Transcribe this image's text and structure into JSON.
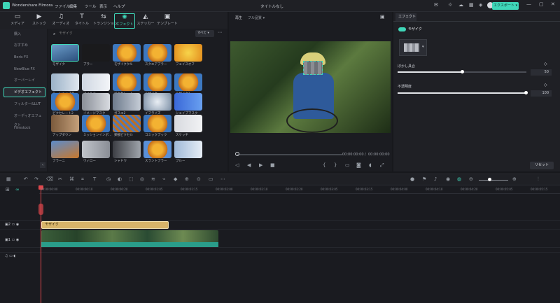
{
  "app": {
    "title": "Wondershare Filmora",
    "doc_title": "タイトルなし",
    "export_label": "エクスポート"
  },
  "menu": [
    "ファイル",
    "編集",
    "ツール",
    "表示",
    "ヘルプ"
  ],
  "toolbar": [
    {
      "label": "メディア",
      "icon": "media-icon"
    },
    {
      "label": "ストック",
      "icon": "stock-icon"
    },
    {
      "label": "オーディオ",
      "icon": "audio-icon"
    },
    {
      "label": "タイトル",
      "icon": "title-icon"
    },
    {
      "label": "トランジション",
      "icon": "transition-icon"
    },
    {
      "label": "エフェクト",
      "icon": "effects-icon",
      "active": true
    },
    {
      "label": "ステッカー",
      "icon": "sticker-icon"
    },
    {
      "label": "テンプレート",
      "icon": "template-icon"
    }
  ],
  "sidebar": [
    "購入",
    "おすすめ",
    "Boris FX",
    "NewBlue FX",
    "オーバーレイ",
    "ビデオエフェクト",
    "フィルター&LUT",
    "オーディオエフェクト",
    "Filmstock"
  ],
  "search": {
    "placeholder": "モザイク",
    "filter": "すべて"
  },
  "effects": [
    "モザイク",
    "ブラー",
    "モザイククル",
    "スクエアブラー",
    "フェイスオフ",
    "モーションブラー",
    "マイルド",
    "ピクセレート",
    "モザイク",
    "モザイク1",
    "ピクセレート2",
    "イメージマスク",
    "ガスエ2",
    "イフライズ",
    "シェイプマスク",
    "アップダウン",
    "ミッションインポ…",
    "楽観ピクセル",
    "コミックブック",
    "スケッチ",
    "ブラーニ",
    "ウィロー",
    "シャドウ",
    "スラントブラー",
    "ブルー"
  ],
  "preview": {
    "play_label": "再生",
    "quality": "フル品質",
    "time_current": "00:00:00:00",
    "time_total": "00:00:00:00"
  },
  "props": {
    "tab": "エフェクト",
    "effect_name": "モザイク",
    "blur_label": "ぼかし具合",
    "blur_value": "50",
    "opacity_label": "不透明度",
    "opacity_value": "100",
    "reset_label": "リセット",
    "blur_level": 0.5,
    "opacity_level": 1.0
  },
  "ruler": [
    "00:00:00:00",
    "00:00:00:10",
    "00:00:00:20",
    "00:00:01:05",
    "00:00:01:15",
    "00:00:02:00",
    "00:00:02:10",
    "00:00:02:20",
    "00:00:03:05",
    "00:00:03:15",
    "00:00:04:00",
    "00:00:04:10",
    "00:00:04:20",
    "00:00:05:05",
    "00:00:05:15"
  ],
  "timeline": {
    "effect_clip": "モザイク",
    "track2": "2",
    "track1": "1"
  },
  "colors": {
    "accent": "#3fd6b8",
    "effect_clip": "#d7b46a",
    "video_clip": "#2a9d8a",
    "playhead": "#e0464b"
  }
}
